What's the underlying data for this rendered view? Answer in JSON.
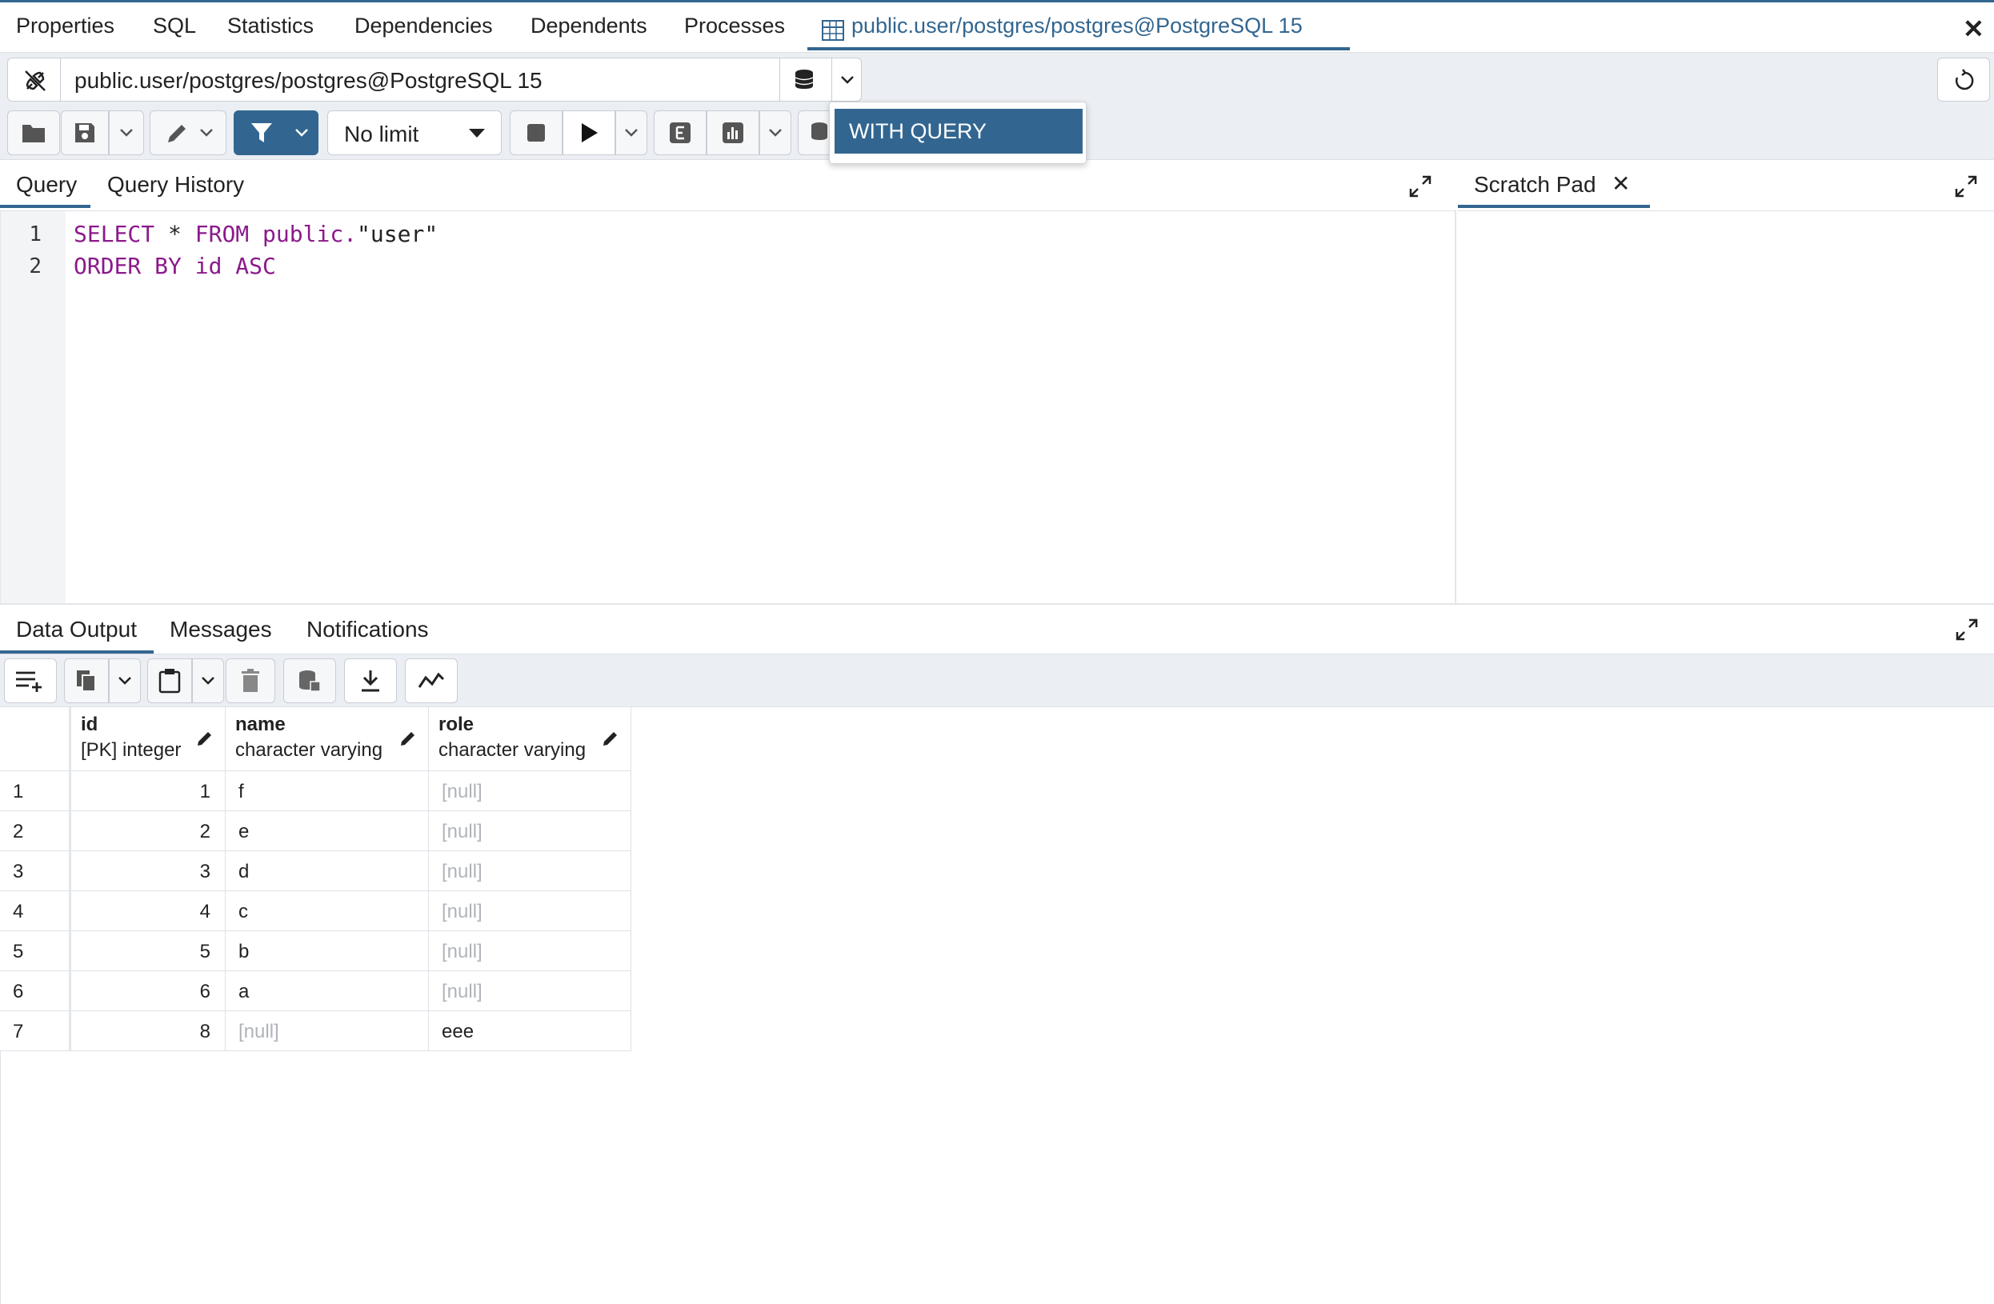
{
  "top_tabs": [
    {
      "label": "Properties"
    },
    {
      "label": "SQL"
    },
    {
      "label": "Statistics"
    },
    {
      "label": "Dependencies"
    },
    {
      "label": "Dependents"
    },
    {
      "label": "Processes"
    },
    {
      "label": "public.user/postgres/postgres@PostgreSQL 15",
      "active": true,
      "icon": "table-icon"
    }
  ],
  "connection": {
    "value": "public.user/postgres/postgres@PostgreSQL 15"
  },
  "toolbar": {
    "limit_value": "No limit"
  },
  "dropdown_menu": {
    "items": [
      "WITH QUERY"
    ]
  },
  "query_tabs": [
    "Query",
    "Query History"
  ],
  "scratch_pad": {
    "label": "Scratch Pad"
  },
  "editor": {
    "lines": [
      {
        "no": "1",
        "tokens": [
          [
            "kw",
            "SELECT"
          ],
          [
            "txt",
            " * "
          ],
          [
            "kw",
            "FROM"
          ],
          [
            "txt",
            " "
          ],
          [
            "kw",
            "public."
          ],
          [
            "txt",
            "\"user\""
          ]
        ]
      },
      {
        "no": "2",
        "tokens": [
          [
            "kw",
            "ORDER BY"
          ],
          [
            "txt",
            " "
          ],
          [
            "kw",
            "id"
          ],
          [
            "txt",
            " "
          ],
          [
            "kw",
            "ASC"
          ]
        ]
      }
    ]
  },
  "output_tabs": [
    "Data Output",
    "Messages",
    "Notifications"
  ],
  "grid": {
    "columns": [
      {
        "name": "id",
        "type": "[PK] integer"
      },
      {
        "name": "name",
        "type": "character varying"
      },
      {
        "name": "role",
        "type": "character varying"
      }
    ],
    "rows": [
      {
        "n": "1",
        "id": "1",
        "name": "f",
        "role": "[null]"
      },
      {
        "n": "2",
        "id": "2",
        "name": "e",
        "role": "[null]"
      },
      {
        "n": "3",
        "id": "3",
        "name": "d",
        "role": "[null]"
      },
      {
        "n": "4",
        "id": "4",
        "name": "c",
        "role": "[null]"
      },
      {
        "n": "5",
        "id": "5",
        "name": "b",
        "role": "[null]"
      },
      {
        "n": "6",
        "id": "6",
        "name": "a",
        "role": "[null]"
      },
      {
        "n": "7",
        "id": "8",
        "name": "[null]",
        "role": "eee"
      }
    ]
  },
  "colors": {
    "accent": "#326690",
    "keyword": "#8b1a8b",
    "null_text": "#b0b4ba"
  }
}
